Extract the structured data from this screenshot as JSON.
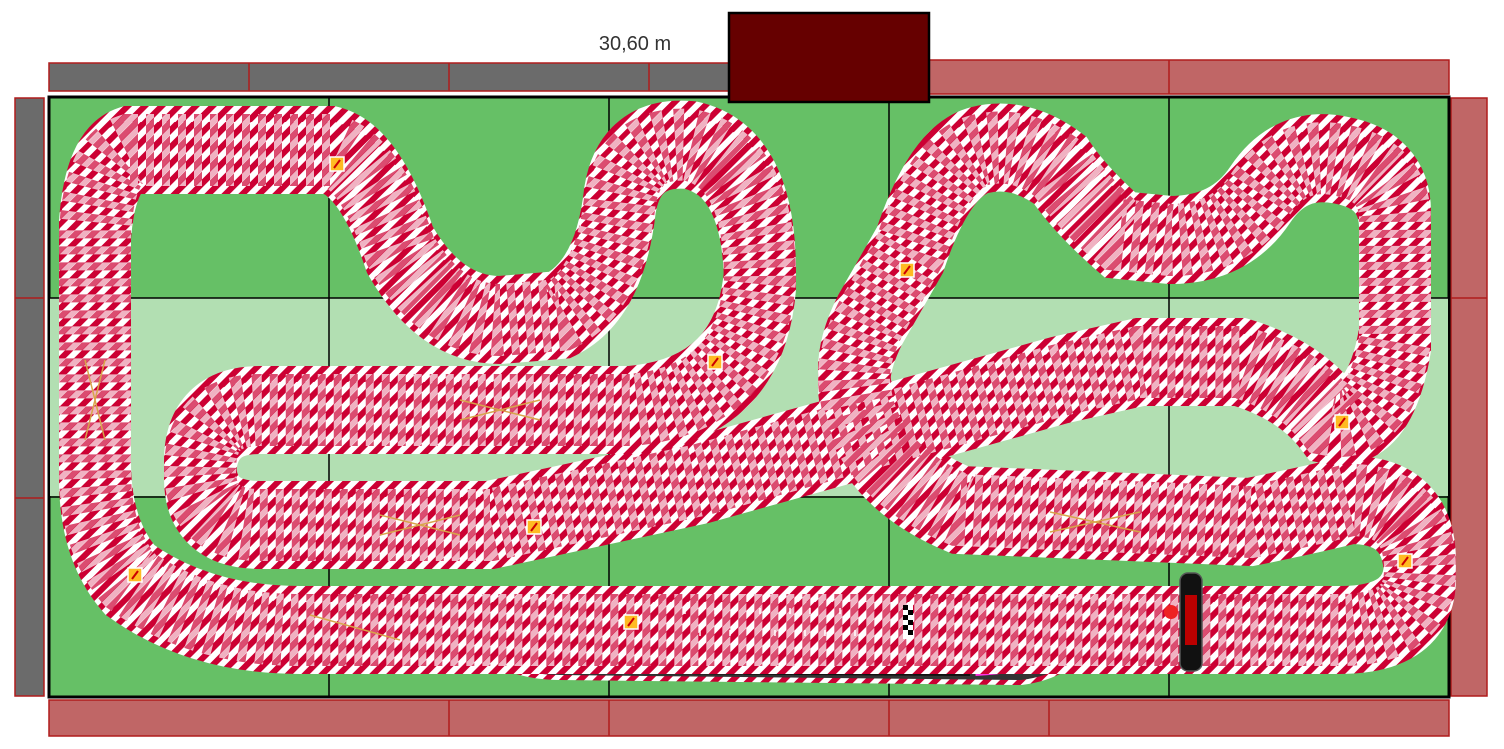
{
  "diagram": {
    "track_length": "30,60 m",
    "colors": {
      "board": "#66c066",
      "board_light": "#b2dfb2",
      "wall_grey": "#6b6b6b",
      "wall_red": "#c06666",
      "wall_border": "#b01c1c",
      "control_box": "#660000",
      "asphalt": "#333333",
      "lane_blue": "#1a6fe6",
      "lane_green": "#22e022",
      "lane_magenta": "#ff33e0",
      "lane_grey": "#8a8a8a",
      "lane_black": "#111111",
      "curb_red": "#cc0033"
    },
    "icons": {
      "lane_change": "lane-change-icon",
      "start_gate": "start-gate-icon",
      "finish_line": "finish-line-icon"
    }
  }
}
